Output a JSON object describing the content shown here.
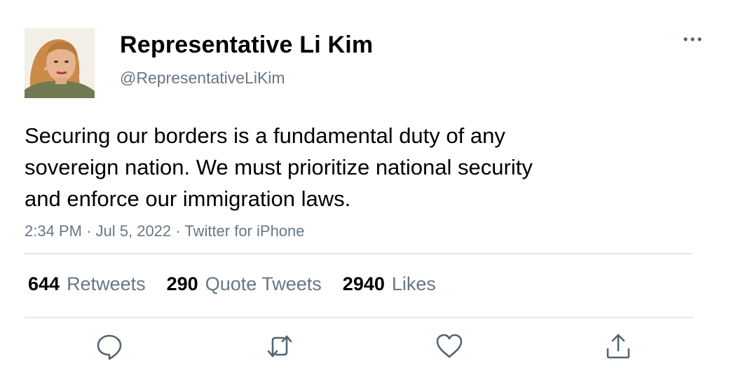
{
  "author": {
    "display_name": "Representative Li Kim",
    "handle": "@RepresentativeLiKim"
  },
  "tweet": {
    "text_lines": [
      "Securing our borders is a fundamental duty of any",
      "sovereign nation. We must prioritize national security",
      "and enforce our immigration laws."
    ],
    "time": "2:34 PM",
    "date": "Jul 5, 2022",
    "source": "Twitter for iPhone",
    "separator": "·"
  },
  "stats": {
    "retweets": {
      "count": "644",
      "label": "Retweets"
    },
    "quote_tweets": {
      "count": "290",
      "label": "Quote Tweets"
    },
    "likes": {
      "count": "2940",
      "label": "Likes"
    }
  },
  "icons": {
    "more": "more-horizontal-icon",
    "reply": "reply-icon",
    "retweet": "retweet-icon",
    "like": "heart-icon",
    "share": "share-icon"
  },
  "colors": {
    "text": "#000000",
    "secondary": "#687684",
    "divider": "#e1e8ed",
    "icon": "#536471"
  }
}
